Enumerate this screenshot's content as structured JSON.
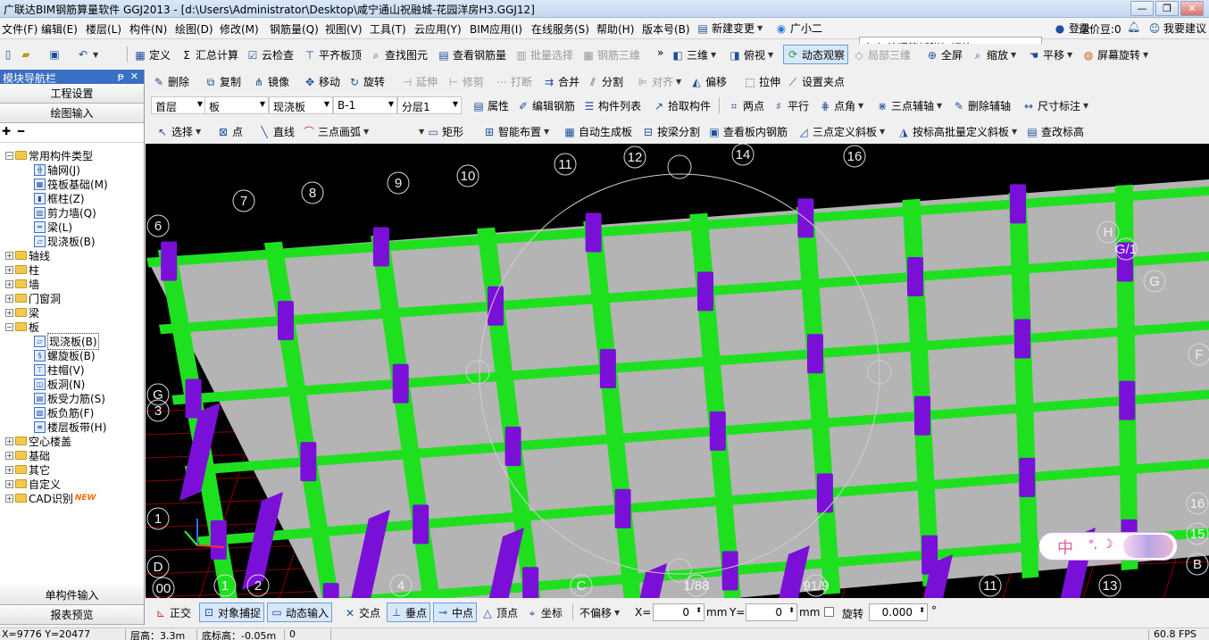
{
  "window": {
    "title": "广联达BIM钢筋算量软件 GGJ2013 - [d:\\Users\\Administrator\\Desktop\\咸宁通山祝融城-花园洋房H3.GGJ12]",
    "min": "—",
    "max": "❐",
    "close": "✕"
  },
  "menu": [
    {
      "label": "文件(F)"
    },
    {
      "label": "编辑(E)"
    },
    {
      "label": "楼层(L)"
    },
    {
      "label": "构件(N)"
    },
    {
      "label": "绘图(D)"
    },
    {
      "label": "修改(M)"
    },
    {
      "label": "钢筋量(Q)"
    },
    {
      "label": "视图(V)"
    },
    {
      "label": "工具(T)"
    },
    {
      "label": "云应用(Y)"
    },
    {
      "label": "BIM应用(I)"
    },
    {
      "label": "在线服务(S)"
    },
    {
      "label": "帮助(H)"
    },
    {
      "label": "版本号(B)"
    }
  ],
  "menu_right": {
    "new_change": "新建变更",
    "guangxiao": "广小二",
    "search": "如何处理筏板附加钢筋...",
    "login": "登录",
    "zaojiadou": "造价豆:0",
    "suggest": "我要建议"
  },
  "toolbar1": [
    {
      "label": "定义"
    },
    {
      "label": "汇总计算"
    },
    {
      "label": "云检查"
    },
    {
      "label": "平齐板顶"
    },
    {
      "label": "查找图元"
    },
    {
      "label": "查看钢筋量"
    },
    {
      "label": "批量选择"
    },
    {
      "label": "钢筋三维"
    },
    {
      "label": "三维"
    },
    {
      "label": "俯视"
    },
    {
      "label": "动态观察"
    },
    {
      "label": "局部三维"
    },
    {
      "label": "全屏"
    },
    {
      "label": "缩放"
    },
    {
      "label": "平移"
    },
    {
      "label": "屏幕旋转"
    }
  ],
  "toolbar2": [
    {
      "label": "删除"
    },
    {
      "label": "复制"
    },
    {
      "label": "镜像"
    },
    {
      "label": "移动"
    },
    {
      "label": "旋转"
    },
    {
      "label": "延伸"
    },
    {
      "label": "修剪"
    },
    {
      "label": "打断"
    },
    {
      "label": "合并"
    },
    {
      "label": "分割"
    },
    {
      "label": "对齐"
    },
    {
      "label": "偏移"
    },
    {
      "label": "拉伸"
    },
    {
      "label": "设置夹点"
    }
  ],
  "toolbar3": {
    "floor": "首层",
    "category": "板",
    "type": "现浇板",
    "component": "B-1",
    "layer": "分层1",
    "buttons": [
      {
        "label": "属性"
      },
      {
        "label": "编辑钢筋"
      },
      {
        "label": "构件列表"
      },
      {
        "label": "拾取构件"
      },
      {
        "label": "两点"
      },
      {
        "label": "平行"
      },
      {
        "label": "点角"
      },
      {
        "label": "三点辅轴"
      },
      {
        "label": "删除辅轴"
      },
      {
        "label": "尺寸标注"
      }
    ]
  },
  "toolbar4": [
    {
      "label": "选择"
    },
    {
      "label": "点"
    },
    {
      "label": "直线"
    },
    {
      "label": "三点画弧"
    },
    {
      "label": "矩形"
    },
    {
      "label": "智能布置"
    },
    {
      "label": "自动生成板"
    },
    {
      "label": "按梁分割"
    },
    {
      "label": "查看板内钢筋"
    },
    {
      "label": "三点定义斜板"
    },
    {
      "label": "按标高批量定义斜板"
    },
    {
      "label": "查改标高"
    }
  ],
  "left_panel": {
    "header": "模块导航栏",
    "pin": "ᵽ",
    "close": "✕",
    "btn_project": "工程设置",
    "btn_draw": "绘图输入",
    "btn_single": "单构件输入",
    "btn_report": "报表预览",
    "tree": [
      {
        "label": "常用构件类型",
        "level": 0,
        "expanded": true,
        "icon": "folder-icon"
      },
      {
        "label": "轴网(J)",
        "level": 1,
        "icon": "axis-grid-icon"
      },
      {
        "label": "筏板基础(M)",
        "level": 1,
        "icon": "raft-foundation-icon"
      },
      {
        "label": "框柱(Z)",
        "level": 1,
        "icon": "frame-column-icon"
      },
      {
        "label": "剪力墙(Q)",
        "level": 1,
        "icon": "shear-wall-icon"
      },
      {
        "label": "梁(L)",
        "level": 1,
        "icon": "beam-icon"
      },
      {
        "label": "现浇板(B)",
        "level": 1,
        "icon": "cast-slab-icon"
      },
      {
        "label": "轴线",
        "level": 0,
        "expanded": false,
        "icon": "folder-icon"
      },
      {
        "label": "柱",
        "level": 0,
        "expanded": false,
        "icon": "folder-icon"
      },
      {
        "label": "墙",
        "level": 0,
        "expanded": false,
        "icon": "folder-icon"
      },
      {
        "label": "门窗洞",
        "level": 0,
        "expanded": false,
        "icon": "folder-icon"
      },
      {
        "label": "梁",
        "level": 0,
        "expanded": false,
        "icon": "folder-icon"
      },
      {
        "label": "板",
        "level": 0,
        "expanded": true,
        "icon": "folder-icon"
      },
      {
        "label": "现浇板(B)",
        "level": 1,
        "icon": "cast-slab-icon",
        "selected": true
      },
      {
        "label": "螺旋板(B)",
        "level": 1,
        "icon": "spiral-slab-icon"
      },
      {
        "label": "柱帽(V)",
        "level": 1,
        "icon": "column-cap-icon"
      },
      {
        "label": "板洞(N)",
        "level": 1,
        "icon": "slab-hole-icon"
      },
      {
        "label": "板受力筋(S)",
        "level": 1,
        "icon": "slab-rebar-icon"
      },
      {
        "label": "板负筋(F)",
        "level": 1,
        "icon": "slab-neg-rebar-icon"
      },
      {
        "label": "楼层板带(H)",
        "level": 1,
        "icon": "slab-band-icon"
      },
      {
        "label": "空心楼盖",
        "level": 0,
        "expanded": false,
        "icon": "folder-icon"
      },
      {
        "label": "基础",
        "level": 0,
        "expanded": false,
        "icon": "folder-icon"
      },
      {
        "label": "其它",
        "level": 0,
        "expanded": false,
        "icon": "folder-icon"
      },
      {
        "label": "自定义",
        "level": 0,
        "expanded": false,
        "icon": "folder-icon"
      },
      {
        "label": "CAD识别",
        "level": 0,
        "expanded": false,
        "icon": "folder-icon",
        "badge": "NEW"
      }
    ]
  },
  "viewport": {
    "axis_labels_top": [
      "6",
      "7",
      "8",
      "9",
      "10",
      "11",
      "12",
      "14",
      "16"
    ],
    "axis_labels_right": [
      "H",
      "G/1",
      "G",
      "F",
      "16",
      "15",
      "B"
    ],
    "axis_labels_left": [
      "G",
      "3",
      "1",
      "D",
      "00"
    ],
    "axis_labels_bottom": [
      "1",
      "2",
      "4",
      "C",
      "1/88",
      "91/9",
      "11",
      "13"
    ],
    "colors": {
      "beam": "#1fe01f",
      "column": "#7a10d8",
      "slab": "#b4b4b4",
      "background": "#000000",
      "grid": "#8b0000"
    }
  },
  "snapbar": {
    "ortho": "正交",
    "osnap": "对象捕捉",
    "dyn_input": "动态输入",
    "intersection": "交点",
    "perpendicular": "垂点",
    "midpoint": "中点",
    "vertex": "顶点",
    "coord": "坐标",
    "offset_mode": "不偏移",
    "x_label": "X=",
    "x_value": "0",
    "mm1": "mm",
    "y_label": "Y=",
    "y_value": "0",
    "mm2": "mm",
    "rotate": "旋转",
    "rotate_value": "0.000",
    "degree": "°"
  },
  "status": {
    "coords": "X=9776 Y=20477",
    "floor_height": "层高：3.3m",
    "base_elev": "底标高：-0.05m",
    "zero": "0",
    "fps": "60.8 FPS"
  },
  "ime": {
    "char": "中",
    "dots": "°,",
    "moon": "☽"
  }
}
